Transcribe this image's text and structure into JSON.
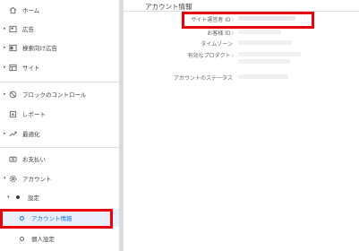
{
  "sidebar": {
    "items": [
      {
        "label": "ホーム",
        "icon": "home-icon"
      },
      {
        "label": "広告",
        "icon": "ad-unit-icon"
      },
      {
        "label": "検索向け広告",
        "icon": "search-ads-icon"
      },
      {
        "label": "サイト",
        "icon": "sites-icon"
      },
      {
        "label": "ブロックのコントロール",
        "icon": "block-icon"
      },
      {
        "label": "レポート",
        "icon": "report-icon"
      },
      {
        "label": "最適化",
        "icon": "trend-up-icon"
      },
      {
        "label": "お支払い",
        "icon": "payments-icon"
      },
      {
        "label": "アカウント",
        "icon": "gear-icon"
      },
      {
        "label": "設定",
        "icon": "dot-icon"
      },
      {
        "label": "アカウント情報",
        "icon": "circle-icon"
      },
      {
        "label": "個人設定",
        "icon": "circle-icon"
      }
    ]
  },
  "main": {
    "section_title": "アカウント情報",
    "rows": [
      {
        "label": "サイト運営者 ID",
        "help": "?"
      },
      {
        "label": "お客様 ID",
        "help": "?"
      },
      {
        "label": "タイムゾーン",
        "help": ""
      },
      {
        "label": "有効なプロダクト",
        "help": "?"
      },
      {
        "label": "アカウントのステータス",
        "help": ""
      }
    ]
  },
  "colors": {
    "highlight": "#e8000b",
    "active_bg": "#e8f0fe",
    "active_text": "#1a73e8"
  }
}
